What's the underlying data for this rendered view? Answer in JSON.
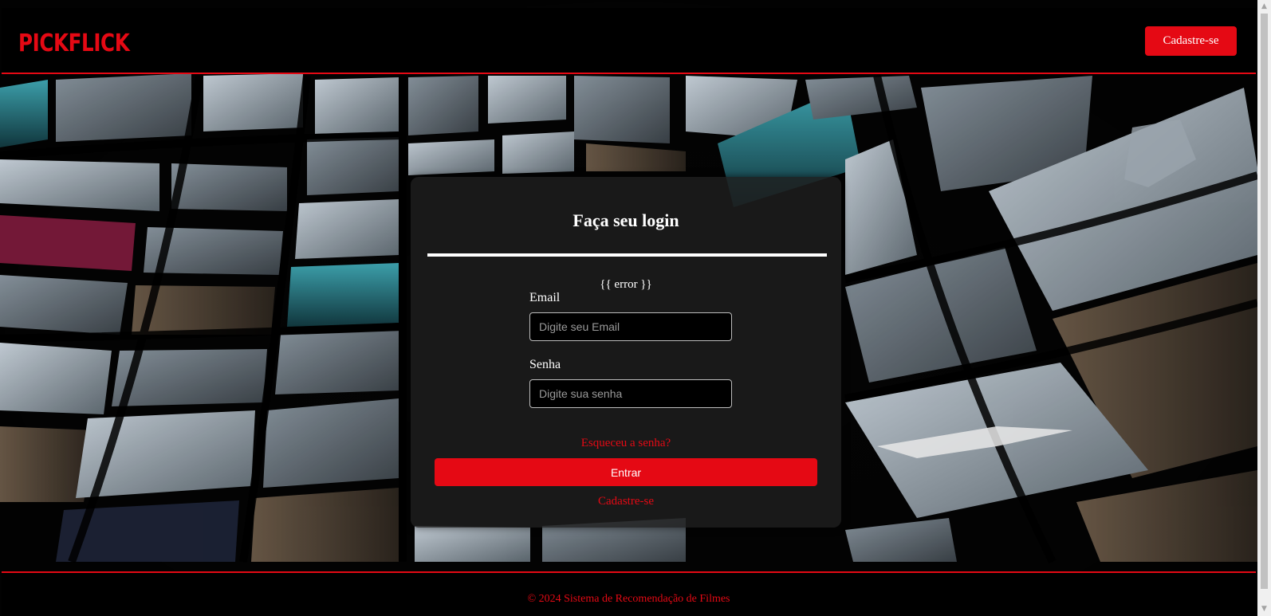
{
  "header": {
    "logo": "PICKFLICK",
    "signup_button": "Cadastre-se"
  },
  "login": {
    "title": "Faça seu login",
    "error": "{{ error }}",
    "email_label": "Email",
    "email_placeholder": "Digite seu Email",
    "email_value": "",
    "password_label": "Senha",
    "password_placeholder": "Digite sua senha",
    "password_value": "",
    "forgot_link": "Esqueceu a senha?",
    "submit_button": "Entrar",
    "signup_link": "Cadastre-se"
  },
  "footer": {
    "text": "© 2024 Sistema de Recomendação de Filmes"
  },
  "colors": {
    "accent": "#e50914",
    "header_bg": "#000000",
    "card_bg": "#1e1e1e"
  },
  "icons": [
    "scroll-up-arrow-icon",
    "scroll-down-arrow-icon"
  ]
}
